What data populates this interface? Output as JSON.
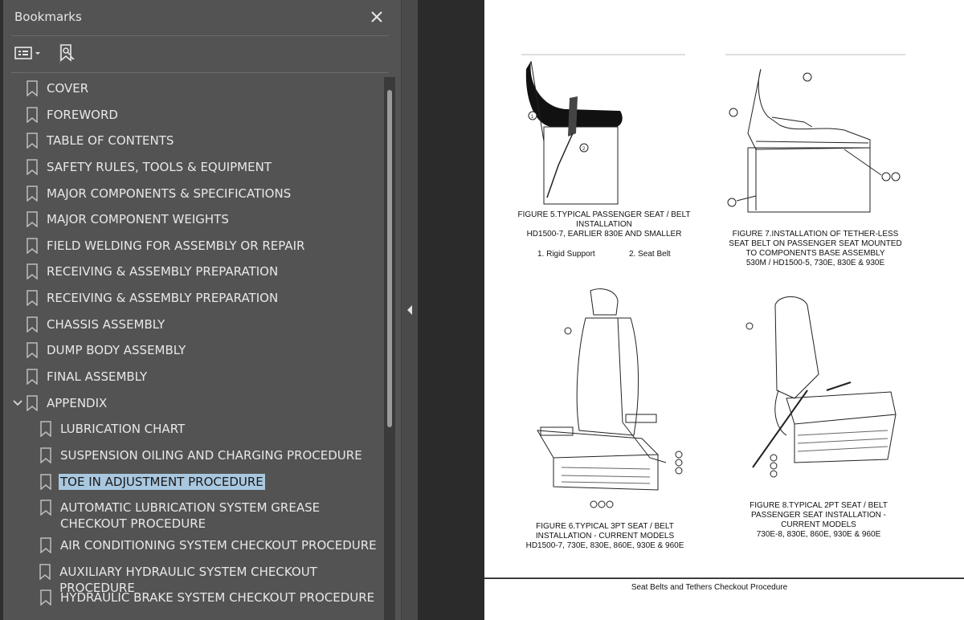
{
  "panel": {
    "title": "Bookmarks",
    "close_symbol": "✕",
    "icons": {
      "options": "bookmark-options-icon",
      "find": "find-bookmark-icon",
      "close": "close-icon"
    },
    "bookmarks": [
      {
        "label": "COVER"
      },
      {
        "label": "FOREWORD"
      },
      {
        "label": "TABLE OF CONTENTS"
      },
      {
        "label": "SAFETY RULES, TOOLS & EQUIPMENT"
      },
      {
        "label": "MAJOR COMPONENTS & SPECIFICATIONS"
      },
      {
        "label": "MAJOR COMPONENT WEIGHTS"
      },
      {
        "label": "FIELD WELDING FOR ASSEMBLY OR REPAIR"
      },
      {
        "label": "RECEIVING & ASSEMBLY PREPARATION"
      },
      {
        "label": "RECEIVING & ASSEMBLY PREPARATION"
      },
      {
        "label": "CHASSIS ASSEMBLY"
      },
      {
        "label": "DUMP BODY ASSEMBLY"
      },
      {
        "label": "FINAL ASSEMBLY"
      },
      {
        "label": "APPENDIX",
        "expanded": true
      },
      {
        "label": "LUBRICATION CHART"
      },
      {
        "label": "SUSPENSION OILING AND CHARGING PROCEDURE"
      },
      {
        "label": "TOE IN ADJUSTMENT PROCEDURE",
        "selected": true
      },
      {
        "label": "AUTOMATIC LUBRICATION SYSTEM GREASE CHECKOUT PROCEDURE"
      },
      {
        "label": "AIR CONDITIONING SYSTEM CHECKOUT PROCEDURE"
      },
      {
        "label": "AUXILIARY HYDRAULIC SYSTEM CHECKOUT PROCEDURE"
      },
      {
        "label": "HYDRAULIC BRAKE SYSTEM CHECKOUT PROCEDURE"
      }
    ]
  },
  "document": {
    "fig5": {
      "line1": "FIGURE 5.TYPICAL PASSENGER SEAT / BELT",
      "line2": "INSTALLATION",
      "line3": "HD1500-7, EARLIER 830E AND SMALLER",
      "legend1": "1. Rigid Support",
      "legend2": "2. Seat Belt"
    },
    "fig7": {
      "line1": "FIGURE 7.INSTALLATION OF TETHER-LESS",
      "line2": "SEAT BELT ON PASSENGER SEAT MOUNTED",
      "line3": "TO COMPONENTS BASE ASSEMBLY",
      "line4": "530M / HD1500-5, 730E, 830E & 930E"
    },
    "fig6": {
      "line1": "FIGURE 6.TYPICAL 3PT SEAT / BELT",
      "line2": "INSTALLATION - CURRENT MODELS",
      "line3": "HD1500-7, 730E, 830E, 860E, 930E & 960E"
    },
    "fig8": {
      "line1": "FIGURE 8.TYPICAL 2PT SEAT / BELT",
      "line2": "PASSENGER SEAT INSTALLATION -",
      "line3": "CURRENT MODELS",
      "line4": "730E-8, 830E, 860E, 930E & 960E"
    },
    "footer": "Seat Belts and Tethers Checkout Procedure"
  },
  "colors": {
    "panel_bg": "#535353",
    "selection": "#a9c8e0",
    "doc_bg": "#2b2b2b"
  }
}
